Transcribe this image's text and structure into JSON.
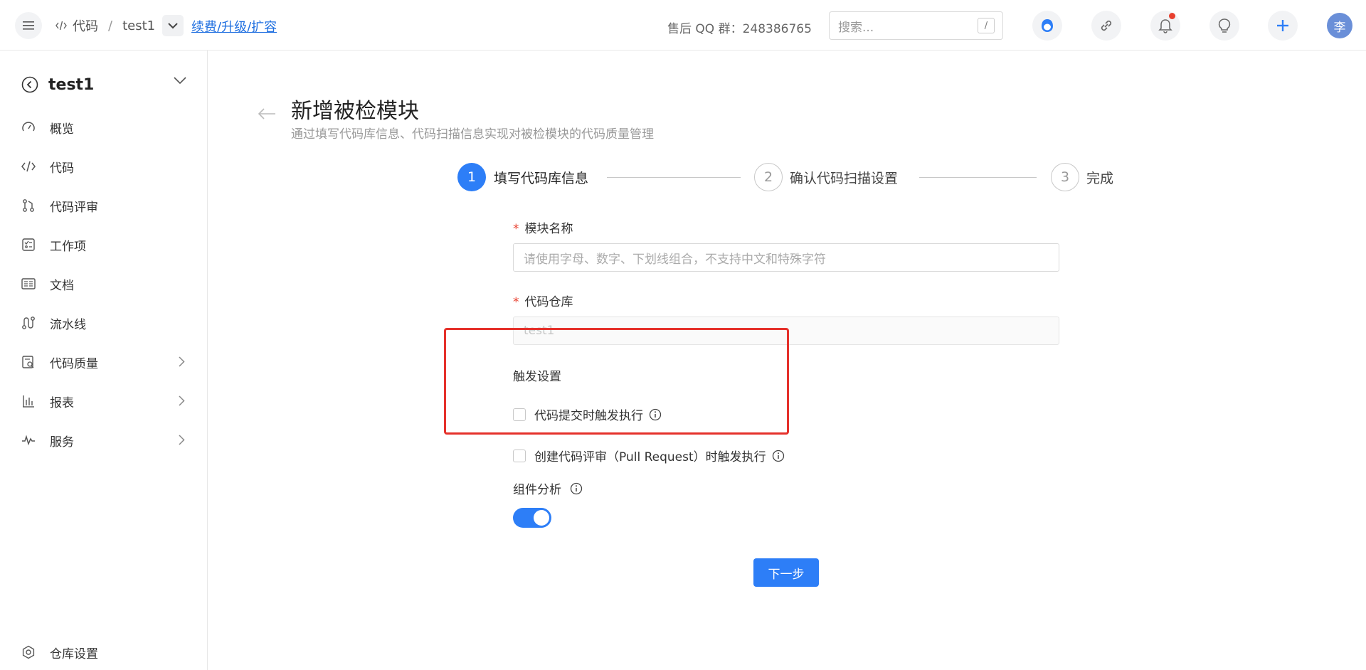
{
  "header": {
    "breadcrumb_code": "代码",
    "breadcrumb_sep": "/",
    "breadcrumb_repo": "test1",
    "renew_link": "续费/升级/扩容",
    "qq_group": "售后 QQ 群：248386765",
    "search_placeholder": "搜索...",
    "search_shortcut": "/",
    "avatar_text": "李"
  },
  "sidebar": {
    "project_name": "test1",
    "items": [
      {
        "label": "概览"
      },
      {
        "label": "代码"
      },
      {
        "label": "代码评审"
      },
      {
        "label": "工作项"
      },
      {
        "label": "文档"
      },
      {
        "label": "流水线"
      },
      {
        "label": "代码质量"
      },
      {
        "label": "报表"
      },
      {
        "label": "服务"
      }
    ],
    "settings_label": "仓库设置"
  },
  "main": {
    "title": "新增被检模块",
    "subtitle": "通过填写代码库信息、代码扫描信息实现对被检模块的代码质量管理",
    "steps": [
      {
        "num": "1",
        "label": "填写代码库信息"
      },
      {
        "num": "2",
        "label": "确认代码扫描设置"
      },
      {
        "num": "3",
        "label": "完成"
      }
    ],
    "form": {
      "required_mark": "*",
      "module_name_label": "模块名称",
      "module_name_placeholder": "请使用字母、数字、下划线组合，不支持中文和特殊字符",
      "repo_label": "代码仓库",
      "repo_value": "test1",
      "trigger_label": "触发设置",
      "trigger_commit": "代码提交时触发执行",
      "trigger_pr": "创建代码评审（Pull Request）时触发执行",
      "component_label": "组件分析",
      "next_button": "下一步"
    }
  }
}
